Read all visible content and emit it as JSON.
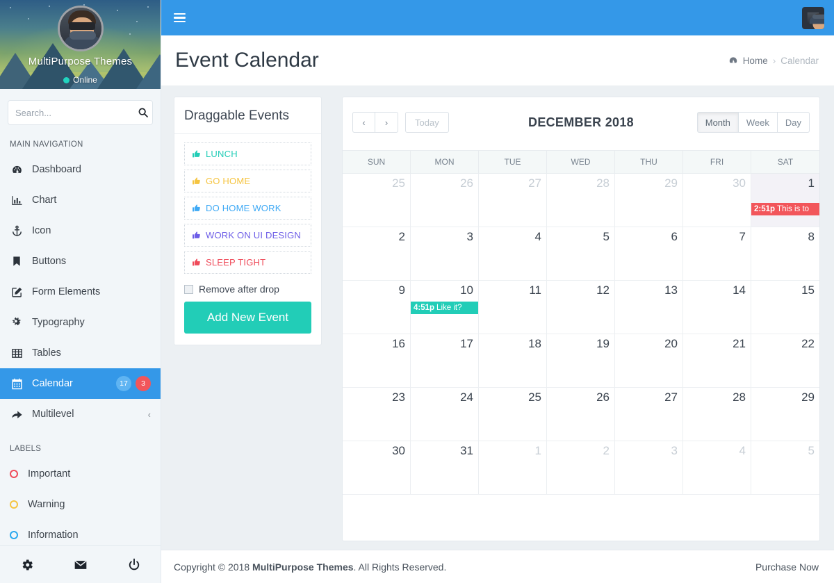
{
  "sidebar": {
    "profile": {
      "name": "MultiPurpose Themes",
      "status": "Online"
    },
    "search": {
      "placeholder": "Search...",
      "value": ""
    },
    "main_nav_label": "MAIN NAVIGATION",
    "items": [
      {
        "label": "Dashboard",
        "icon": "dashboard-icon"
      },
      {
        "label": "Chart",
        "icon": "bar-chart-icon"
      },
      {
        "label": "Icon",
        "icon": "anchor-icon"
      },
      {
        "label": "Buttons",
        "icon": "bookmark-icon"
      },
      {
        "label": "Form Elements",
        "icon": "edit-square-icon"
      },
      {
        "label": "Typography",
        "icon": "gears-icon"
      },
      {
        "label": "Tables",
        "icon": "table-icon"
      },
      {
        "label": "Calendar",
        "icon": "calendar-icon",
        "active": true,
        "badge_info": "17",
        "badge_danger": "3"
      },
      {
        "label": "Multilevel",
        "icon": "share-arrow-icon",
        "chevron": "‹"
      }
    ],
    "labels_label": "LABELS",
    "labels": [
      {
        "label": "Important",
        "color": "#ef4b5a"
      },
      {
        "label": "Warning",
        "color": "#f5c441"
      },
      {
        "label": "Information",
        "color": "#2aa8ee"
      }
    ],
    "footer_icons": [
      "gear-icon",
      "envelope-icon",
      "power-icon"
    ]
  },
  "topbar": {
    "menu_toggle": "hamburger-icon",
    "avatar": "user-avatar"
  },
  "page": {
    "title": "Event Calendar",
    "breadcrumb": {
      "home": "Home",
      "separator": "›",
      "current": "Calendar"
    }
  },
  "draggable": {
    "title": "Draggable Events",
    "events": [
      {
        "label": "LUNCH",
        "color": "#22cdb7"
      },
      {
        "label": "GO HOME",
        "color": "#f5c441"
      },
      {
        "label": "DO HOME WORK",
        "color": "#3ea9f5"
      },
      {
        "label": "WORK ON UI DESIGN",
        "color": "#6c5ce7"
      },
      {
        "label": "SLEEP TIGHT",
        "color": "#ef4b5a"
      }
    ],
    "remove_after_drop": "Remove after drop",
    "checkbox_checked": false,
    "add_button": "Add New Event"
  },
  "calendar": {
    "prev_label": "‹",
    "next_label": "›",
    "today_label": "Today",
    "title": "DECEMBER 2018",
    "views": [
      {
        "label": "Month",
        "active": true
      },
      {
        "label": "Week",
        "active": false
      },
      {
        "label": "Day",
        "active": false
      }
    ],
    "day_headers": [
      "SUN",
      "MON",
      "TUE",
      "WED",
      "THU",
      "FRI",
      "SAT"
    ],
    "weeks": [
      [
        {
          "num": "25",
          "other": true
        },
        {
          "num": "26",
          "other": true
        },
        {
          "num": "27",
          "other": true
        },
        {
          "num": "28",
          "other": true
        },
        {
          "num": "29",
          "other": true
        },
        {
          "num": "30",
          "other": true
        },
        {
          "num": "1",
          "other": false,
          "today": true,
          "event": {
            "time": "2:51p",
            "title": "This is to",
            "color": "#f2565b"
          }
        }
      ],
      [
        {
          "num": "2"
        },
        {
          "num": "3"
        },
        {
          "num": "4"
        },
        {
          "num": "5"
        },
        {
          "num": "6"
        },
        {
          "num": "7"
        },
        {
          "num": "8"
        }
      ],
      [
        {
          "num": "9"
        },
        {
          "num": "10",
          "event": {
            "time": "4:51p",
            "title": "Like it?",
            "color": "#22cdb7"
          }
        },
        {
          "num": "11"
        },
        {
          "num": "12"
        },
        {
          "num": "13"
        },
        {
          "num": "14"
        },
        {
          "num": "15"
        }
      ],
      [
        {
          "num": "16"
        },
        {
          "num": "17"
        },
        {
          "num": "18"
        },
        {
          "num": "19"
        },
        {
          "num": "20"
        },
        {
          "num": "21"
        },
        {
          "num": "22"
        }
      ],
      [
        {
          "num": "23"
        },
        {
          "num": "24"
        },
        {
          "num": "25"
        },
        {
          "num": "26"
        },
        {
          "num": "27"
        },
        {
          "num": "28"
        },
        {
          "num": "29"
        }
      ],
      [
        {
          "num": "30"
        },
        {
          "num": "31"
        },
        {
          "num": "1",
          "other": true
        },
        {
          "num": "2",
          "other": true
        },
        {
          "num": "3",
          "other": true
        },
        {
          "num": "4",
          "other": true
        },
        {
          "num": "5",
          "other": true
        }
      ]
    ]
  },
  "footer": {
    "copyright_pre": "Copyright © 2018 ",
    "brand": "MultiPurpose Themes",
    "copyright_post": ". All Rights Reserved.",
    "purchase": "Purchase Now"
  },
  "colors": {
    "brand_blue": "#3498e8",
    "teal": "#22cdb7",
    "danger": "#f2565b",
    "sidebar_bg": "#f2f6f9",
    "content_bg": "#ecf0f3"
  }
}
